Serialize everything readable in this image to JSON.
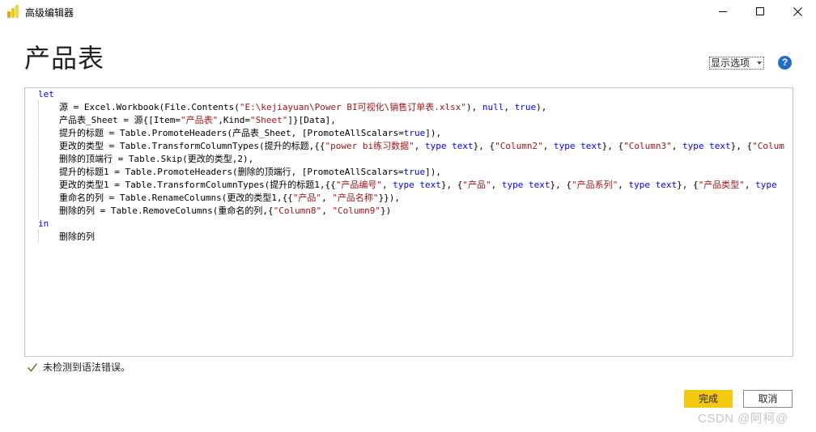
{
  "window": {
    "title": "高级编辑器",
    "controls": [
      "minimize-icon",
      "maximize-icon",
      "close-icon"
    ]
  },
  "header": {
    "title": "产品表",
    "display_options_label": "显示选项",
    "help_label": "?"
  },
  "editor": {
    "lines": [
      [
        {
          "t": "let",
          "c": "kw"
        }
      ],
      [
        {
          "t": "源 = Excel.Workbook(File.Contents(",
          "c": ""
        },
        {
          "t": "\"E:\\kejiayuan\\Power BI可视化\\销售订单表.xlsx\"",
          "c": "str"
        },
        {
          "t": "), ",
          "c": ""
        },
        {
          "t": "null",
          "c": "kw"
        },
        {
          "t": ", ",
          "c": ""
        },
        {
          "t": "true",
          "c": "kw"
        },
        {
          "t": "),",
          "c": ""
        }
      ],
      [
        {
          "t": "产品表_Sheet = 源{[Item=",
          "c": ""
        },
        {
          "t": "\"产品表\"",
          "c": "str"
        },
        {
          "t": ",Kind=",
          "c": ""
        },
        {
          "t": "\"Sheet\"",
          "c": "str"
        },
        {
          "t": "]}[Data],",
          "c": ""
        }
      ],
      [
        {
          "t": "提升的标题 = Table.PromoteHeaders(产品表_Sheet, [PromoteAllScalars=",
          "c": ""
        },
        {
          "t": "true",
          "c": "kw"
        },
        {
          "t": "]),",
          "c": ""
        }
      ],
      [
        {
          "t": "更改的类型 = Table.TransformColumnTypes(提升的标题,{{",
          "c": ""
        },
        {
          "t": "\"power bi练习数据\"",
          "c": "str"
        },
        {
          "t": ", ",
          "c": ""
        },
        {
          "t": "type text",
          "c": "kw"
        },
        {
          "t": "}, {",
          "c": ""
        },
        {
          "t": "\"Column2\"",
          "c": "str"
        },
        {
          "t": ", ",
          "c": ""
        },
        {
          "t": "type text",
          "c": "kw"
        },
        {
          "t": "}, {",
          "c": ""
        },
        {
          "t": "\"Column3\"",
          "c": "str"
        },
        {
          "t": ", ",
          "c": ""
        },
        {
          "t": "type text",
          "c": "kw"
        },
        {
          "t": "}, {",
          "c": ""
        },
        {
          "t": "\"Colum",
          "c": "str"
        }
      ],
      [
        {
          "t": "删除的顶端行 = Table.Skip(更改的类型,2),",
          "c": ""
        }
      ],
      [
        {
          "t": "提升的标题1 = Table.PromoteHeaders(删除的顶端行, [PromoteAllScalars=",
          "c": ""
        },
        {
          "t": "true",
          "c": "kw"
        },
        {
          "t": "]),",
          "c": ""
        }
      ],
      [
        {
          "t": "更改的类型1 = Table.TransformColumnTypes(提升的标题1,{{",
          "c": ""
        },
        {
          "t": "\"产品编号\"",
          "c": "str"
        },
        {
          "t": ", ",
          "c": ""
        },
        {
          "t": "type text",
          "c": "kw"
        },
        {
          "t": "}, {",
          "c": ""
        },
        {
          "t": "\"产品\"",
          "c": "str"
        },
        {
          "t": ", ",
          "c": ""
        },
        {
          "t": "type text",
          "c": "kw"
        },
        {
          "t": "}, {",
          "c": ""
        },
        {
          "t": "\"产品系列\"",
          "c": "str"
        },
        {
          "t": ", ",
          "c": ""
        },
        {
          "t": "type text",
          "c": "kw"
        },
        {
          "t": "}, {",
          "c": ""
        },
        {
          "t": "\"产品类型\"",
          "c": "str"
        },
        {
          "t": ", ",
          "c": ""
        },
        {
          "t": "type",
          "c": "kw"
        }
      ],
      [
        {
          "t": "重命名的列 = Table.RenameColumns(更改的类型1,{{",
          "c": ""
        },
        {
          "t": "\"产品\"",
          "c": "str"
        },
        {
          "t": ", ",
          "c": ""
        },
        {
          "t": "\"产品名称\"",
          "c": "str"
        },
        {
          "t": "}}),",
          "c": ""
        }
      ],
      [
        {
          "t": "删除的列 = Table.RemoveColumns(重命名的列,{",
          "c": ""
        },
        {
          "t": "\"Column8\"",
          "c": "str"
        },
        {
          "t": ", ",
          "c": ""
        },
        {
          "t": "\"Column9\"",
          "c": "str"
        },
        {
          "t": "})",
          "c": ""
        }
      ],
      [
        {
          "t": "in",
          "c": "kw"
        }
      ],
      [
        {
          "t": "删除的列",
          "c": ""
        }
      ]
    ],
    "indented": [
      false,
      true,
      true,
      true,
      true,
      true,
      true,
      true,
      true,
      true,
      false,
      true
    ]
  },
  "status": {
    "icon": "checkmark-icon",
    "text": "未检测到语法错误。",
    "color": "#5b8a3c"
  },
  "buttons": {
    "done_label": "完成",
    "cancel_label": "取消",
    "accent": "#f2c811"
  },
  "watermark": "CSDN @阿柯@"
}
